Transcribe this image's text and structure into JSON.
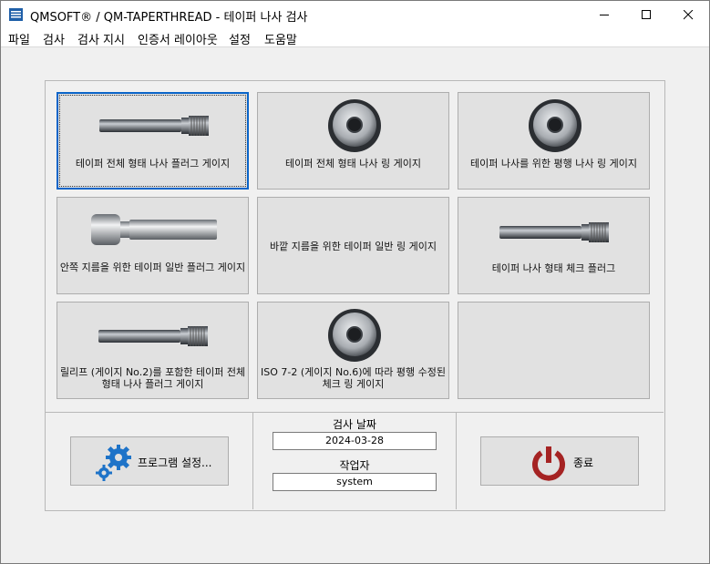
{
  "window": {
    "title": "QMSOFT® / QM-TAPERTHREAD - 테이퍼 나사 검사",
    "controls": [
      "minimize-icon",
      "maximize-icon",
      "close-icon"
    ]
  },
  "menu": [
    "파일",
    "검사",
    "검사 지시",
    "인증서 레이아웃",
    "설정",
    "도움말"
  ],
  "tiles": [
    {
      "label": "테이퍼 전체 형태 나사 플러그 게이지",
      "icon": "threaded-plug-gauge-icon",
      "selected": true
    },
    {
      "label": "테이퍼 전체 형태 나사 링 게이지",
      "icon": "ring-gauge-icon"
    },
    {
      "label": "테이퍼 나사를 위한 평행 나사 링 게이지",
      "icon": "ring-gauge-icon"
    },
    {
      "label": "안쪽 지름을 위한 테이퍼 일반 플러그 게이지",
      "icon": "plain-plug-gauge-icon"
    },
    {
      "label": "바깥 지름을 위한 테이퍼 일반 링 게이지",
      "icon": ""
    },
    {
      "label": "테이퍼 나사 형태 체크 플러그",
      "icon": "check-plug-icon"
    },
    {
      "label": "릴리프 (게이지 No.2)를 포함한 테이퍼 전체 형태 나사 플러그 게이지",
      "icon": "threaded-plug-gauge-icon"
    },
    {
      "label": "ISO 7-2 (게이지 No.6)에 따라 평행 수정된 체크 링 게이지",
      "icon": "ring-gauge-icon"
    },
    {
      "label": "",
      "icon": ""
    }
  ],
  "bottom": {
    "settings_button": "프로그램 설정...",
    "inspection_date_label": "검사 날짜",
    "inspection_date_value": "2024-03-28",
    "operator_label": "작업자",
    "operator_value": "system",
    "exit_button": "종료"
  },
  "colors": {
    "accent": "#0a64c8",
    "gear": "#1e73c8",
    "power": "#a52323"
  }
}
